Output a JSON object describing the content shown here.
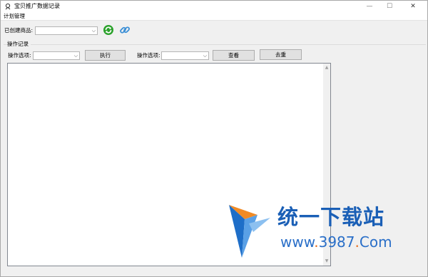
{
  "window": {
    "title": "宝贝推广数据记录",
    "minimize_glyph": "—",
    "maximize_glyph": "☐",
    "close_glyph": "✕"
  },
  "menu": {
    "plan_management": "计划管理"
  },
  "product_row": {
    "label": "已创建商品:",
    "combo_value": "",
    "refresh_icon": "refresh-icon",
    "link_icon": "link-icon",
    "colors": {
      "refresh": "#2aa12a",
      "link": "#3b8fd6"
    }
  },
  "operations_group": {
    "title": "操作记录",
    "option_label_1": "操作选项:",
    "combo_1_value": "",
    "execute_button": "执行",
    "option_label_2": "操作选项:",
    "combo_2_value": "",
    "view_button": "查看",
    "dedupe_button": "去重"
  },
  "log": {
    "content": "",
    "scroll_up_glyph": "▲",
    "scroll_down_glyph": "▼"
  },
  "watermark": {
    "title": "统一下载站",
    "url_prefix": "www",
    "url_dot1": ".",
    "url_domain": "3987",
    "url_dot2": ".",
    "url_tld": "Com",
    "colors": {
      "text": "#1a5fb6",
      "dot": "#e96f1d",
      "logo_blue": "#1e6ec8",
      "logo_orange": "#f08a24"
    }
  }
}
